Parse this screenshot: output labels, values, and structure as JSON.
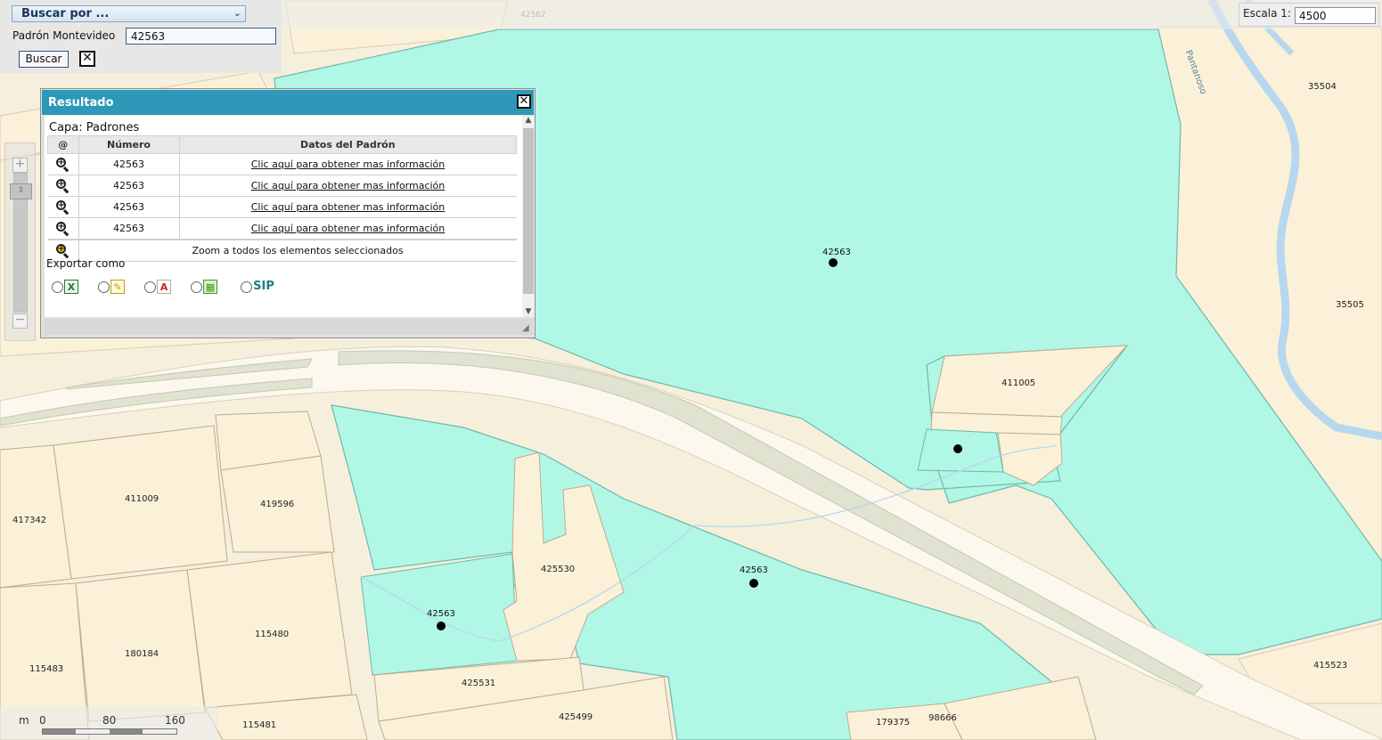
{
  "search": {
    "select_label": "Buscar por ...",
    "field_label": "Padrón Montevideo",
    "field_value": "42563",
    "buscar_label": "Buscar",
    "clear_label": "✕"
  },
  "scale": {
    "label": "Escala 1:",
    "value": "4500"
  },
  "zoom": {
    "in_label": "+",
    "out_label": "−",
    "handle_label": "⇕"
  },
  "result": {
    "title": "Resultado",
    "close_label": "✕",
    "capa": "Capa: Padrones",
    "headers": [
      "@",
      "Número",
      "Datos del Padrón"
    ],
    "rows": [
      {
        "numero": "42563",
        "link": "Clic aquí para obtener mas información"
      },
      {
        "numero": "42563",
        "link": "Clic aquí para obtener mas información"
      },
      {
        "numero": "42563",
        "link": "Clic aquí para obtener mas información"
      },
      {
        "numero": "42563",
        "link": "Clic aquí para obtener mas información"
      }
    ],
    "zoom_all": "Zoom a todos los elementos seleccionados",
    "export_label": "Exportar como",
    "export_options": [
      {
        "icon": "excel-icon",
        "color": "#1f7a3a"
      },
      {
        "icon": "text-edit-icon",
        "color": "#c59a1b"
      },
      {
        "icon": "pdf-icon",
        "color": "#d01d1d"
      },
      {
        "icon": "spreadsheet-icon",
        "color": "#3f9a2a"
      },
      {
        "icon": "sip-logo-icon",
        "color": "#1a7f86"
      }
    ]
  },
  "map": {
    "colors": {
      "highlight": "#b1f7e6",
      "parcel": "#fbf1d8",
      "road": "#fcf8ee",
      "green": "#dfe3cf",
      "water": "#b7d7ee"
    },
    "parcel_labels": [
      "42562",
      "35504",
      "35505",
      "411005",
      "411009",
      "419596",
      "417342",
      "425530",
      "425531",
      "425499",
      "115480",
      "180184",
      "115483",
      "115481",
      "179375",
      "98666",
      "415523"
    ],
    "highlight_labels": [
      "42563",
      "42563",
      "42563"
    ],
    "street_label": "Pantanoso"
  },
  "scalebar": {
    "unit": "m",
    "ticks": [
      "0",
      "80",
      "160"
    ]
  }
}
